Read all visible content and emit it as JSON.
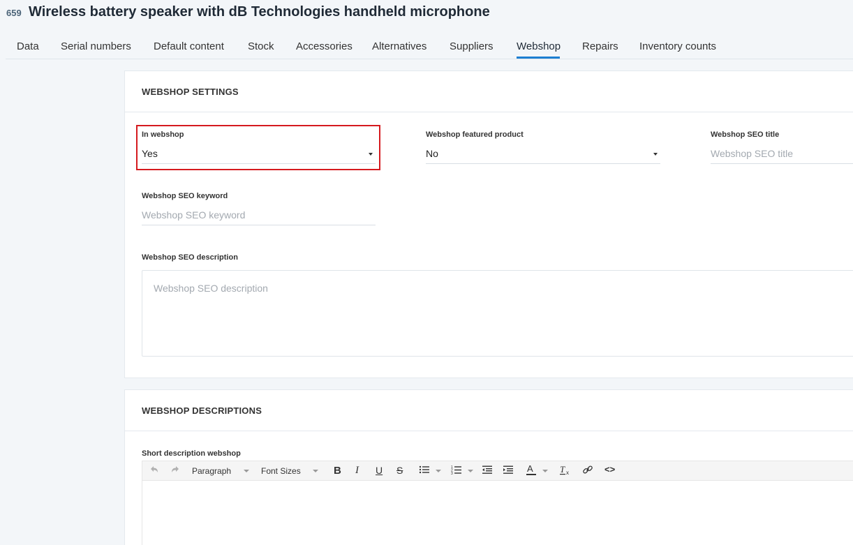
{
  "header": {
    "id": "659",
    "title": "Wireless battery speaker with dB Technologies handheld microphone"
  },
  "tabs": [
    {
      "label": "Data"
    },
    {
      "label": "Serial numbers"
    },
    {
      "label": "Default content"
    },
    {
      "label": "Stock"
    },
    {
      "label": "Accessories"
    },
    {
      "label": "Alternatives"
    },
    {
      "label": "Suppliers"
    },
    {
      "label": "Webshop",
      "active": true
    },
    {
      "label": "Repairs"
    },
    {
      "label": "Inventory counts"
    }
  ],
  "webshop_settings": {
    "title": "WEBSHOP SETTINGS",
    "in_webshop": {
      "label": "In webshop",
      "value": "Yes"
    },
    "featured": {
      "label": "Webshop featured product",
      "value": "No"
    },
    "seo_title": {
      "label": "Webshop SEO title",
      "placeholder": "Webshop SEO title"
    },
    "seo_keyword": {
      "label": "Webshop SEO keyword",
      "placeholder": "Webshop SEO keyword"
    },
    "seo_description": {
      "label": "Webshop SEO description",
      "placeholder": "Webshop SEO description"
    }
  },
  "webshop_descriptions": {
    "title": "WEBSHOP DESCRIPTIONS",
    "short_description": {
      "label": "Short description webshop"
    },
    "toolbar": {
      "paragraph": "Paragraph",
      "font_sizes": "Font Sizes",
      "icons": [
        "undo-icon",
        "redo-icon",
        "bold-icon",
        "italic-icon",
        "underline-icon",
        "strikethrough-icon",
        "bullet-list-icon",
        "numbered-list-icon",
        "outdent-icon",
        "indent-icon",
        "text-color-icon",
        "clear-format-icon",
        "link-icon",
        "code-icon"
      ]
    }
  },
  "colors": {
    "accent": "#1d7fd1",
    "highlight": "#d51a1f",
    "background": "#f3f6f9"
  }
}
